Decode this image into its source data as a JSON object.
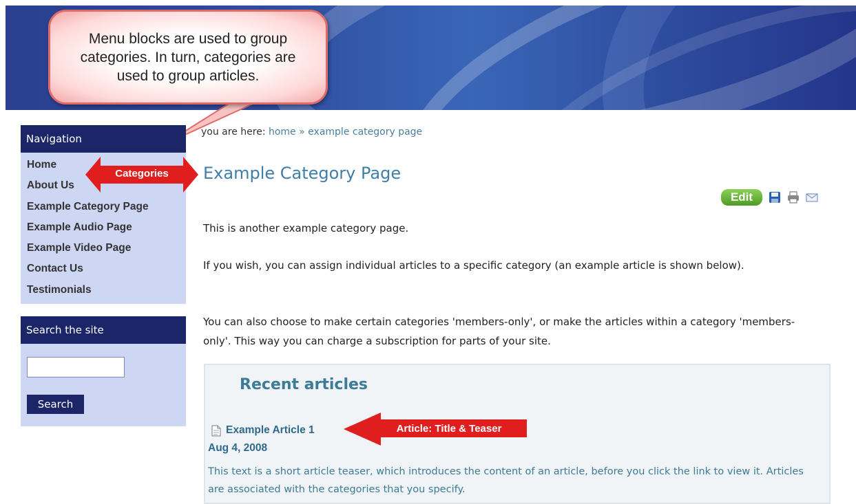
{
  "callout": {
    "text": "Menu blocks are used to group categories. In turn, categories are used to group articles."
  },
  "annotations": {
    "categories_label": "Categories",
    "article_label": "Article: Title & Teaser",
    "arrow_color": "#e01e1e"
  },
  "sidebar": {
    "navigation": {
      "title": "Navigation",
      "items": [
        {
          "label": "Home"
        },
        {
          "label": "About Us"
        },
        {
          "label": "Example Category Page"
        },
        {
          "label": "Example Audio Page"
        },
        {
          "label": "Example Video Page"
        },
        {
          "label": "Contact Us"
        },
        {
          "label": "Testimonials"
        }
      ]
    },
    "search": {
      "title": "Search the site",
      "input_value": "",
      "button_label": "Search"
    }
  },
  "breadcrumb": {
    "prefix": "you are here:",
    "home": "home",
    "separator": "»",
    "current": "example category page"
  },
  "main": {
    "title": "Example Category Page",
    "edit_label": "Edit",
    "paragraphs": [
      "This is another example category page.",
      "If you wish, you can assign individual articles to a specific category (an example article is shown below).",
      "You can also choose to make certain categories 'members-only', or make the articles within a category 'members-only'.  This way you can charge a subscription for parts of your site."
    ],
    "recent": {
      "title": "Recent articles",
      "article_title": "Example Article 1",
      "article_date": "Aug 4, 2008",
      "article_teaser": "This text is a short article teaser, which introduces the content of an article, before you click the link to view it.  Articles are associated with the categories that you specify."
    }
  },
  "colors": {
    "nav_header": "#1b2567",
    "sidebar_bg": "#cdd6f3",
    "title_blue": "#3d7fa8",
    "link_blue": "#4a7f9c"
  },
  "icons": [
    "save-icon",
    "print-icon",
    "email-icon",
    "document-icon"
  ]
}
